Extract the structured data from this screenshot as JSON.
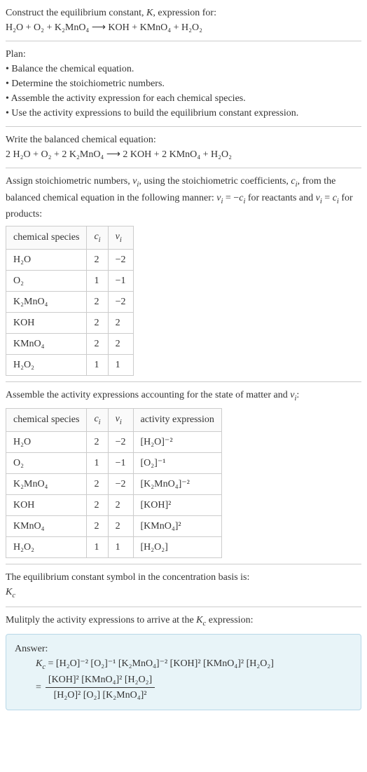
{
  "intro": {
    "line1": "Construct the equilibrium constant, K, expression for:",
    "equation": "H₂O + O₂ + K₂MnO₄  ⟶  KOH + KMnO₄ + H₂O₂"
  },
  "plan": {
    "heading": "Plan:",
    "item1": "• Balance the chemical equation.",
    "item2": "• Determine the stoichiometric numbers.",
    "item3": "• Assemble the activity expression for each chemical species.",
    "item4": "• Use the activity expressions to build the equilibrium constant expression."
  },
  "balanced": {
    "heading": "Write the balanced chemical equation:",
    "equation": "2 H₂O + O₂ + 2 K₂MnO₄  ⟶  2 KOH + 2 KMnO₄ + H₂O₂"
  },
  "assign": {
    "text": "Assign stoichiometric numbers, νᵢ, using the stoichiometric coefficients, cᵢ, from the balanced chemical equation in the following manner: νᵢ = −cᵢ for reactants and νᵢ = cᵢ for products:"
  },
  "table1": {
    "h1": "chemical species",
    "h2": "cᵢ",
    "h3": "νᵢ",
    "r1c1": "H₂O",
    "r1c2": "2",
    "r1c3": "−2",
    "r2c1": "O₂",
    "r2c2": "1",
    "r2c3": "−1",
    "r3c1": "K₂MnO₄",
    "r3c2": "2",
    "r3c3": "−2",
    "r4c1": "KOH",
    "r4c2": "2",
    "r4c3": "2",
    "r5c1": "KMnO₄",
    "r5c2": "2",
    "r5c3": "2",
    "r6c1": "H₂O₂",
    "r6c2": "1",
    "r6c3": "1"
  },
  "assemble": {
    "text": "Assemble the activity expressions accounting for the state of matter and νᵢ:"
  },
  "table2": {
    "h1": "chemical species",
    "h2": "cᵢ",
    "h3": "νᵢ",
    "h4": "activity expression",
    "r1c1": "H₂O",
    "r1c2": "2",
    "r1c3": "−2",
    "r1c4": "[H₂O]⁻²",
    "r2c1": "O₂",
    "r2c2": "1",
    "r2c3": "−1",
    "r2c4": "[O₂]⁻¹",
    "r3c1": "K₂MnO₄",
    "r3c2": "2",
    "r3c3": "−2",
    "r3c4": "[K₂MnO₄]⁻²",
    "r4c1": "KOH",
    "r4c2": "2",
    "r4c3": "2",
    "r4c4": "[KOH]²",
    "r5c1": "KMnO₄",
    "r5c2": "2",
    "r5c3": "2",
    "r5c4": "[KMnO₄]²",
    "r6c1": "H₂O₂",
    "r6c2": "1",
    "r6c3": "1",
    "r6c4": "[H₂O₂]"
  },
  "symbol": {
    "line1": "The equilibrium constant symbol in the concentration basis is:",
    "line2": "K_c"
  },
  "multiply": {
    "text": "Mulitply the activity expressions to arrive at the K_c expression:"
  },
  "answer": {
    "heading": "Answer:",
    "line1": "K_c = [H₂O]⁻² [O₂]⁻¹ [K₂MnO₄]⁻² [KOH]² [KMnO₄]² [H₂O₂]",
    "numerator": "[KOH]² [KMnO₄]² [H₂O₂]",
    "denominator": "[H₂O]² [O₂] [K₂MnO₄]²"
  },
  "chart_data": {
    "type": "table",
    "tables": [
      {
        "title": "Stoichiometric numbers",
        "columns": [
          "chemical species",
          "c_i",
          "ν_i"
        ],
        "rows": [
          [
            "H2O",
            2,
            -2
          ],
          [
            "O2",
            1,
            -1
          ],
          [
            "K2MnO4",
            2,
            -2
          ],
          [
            "KOH",
            2,
            2
          ],
          [
            "KMnO4",
            2,
            2
          ],
          [
            "H2O2",
            1,
            1
          ]
        ]
      },
      {
        "title": "Activity expressions",
        "columns": [
          "chemical species",
          "c_i",
          "ν_i",
          "activity expression"
        ],
        "rows": [
          [
            "H2O",
            2,
            -2,
            "[H2O]^-2"
          ],
          [
            "O2",
            1,
            -1,
            "[O2]^-1"
          ],
          [
            "K2MnO4",
            2,
            -2,
            "[K2MnO4]^-2"
          ],
          [
            "KOH",
            2,
            2,
            "[KOH]^2"
          ],
          [
            "KMnO4",
            2,
            2,
            "[KMnO4]^2"
          ],
          [
            "H2O2",
            1,
            1,
            "[H2O2]"
          ]
        ]
      }
    ]
  }
}
